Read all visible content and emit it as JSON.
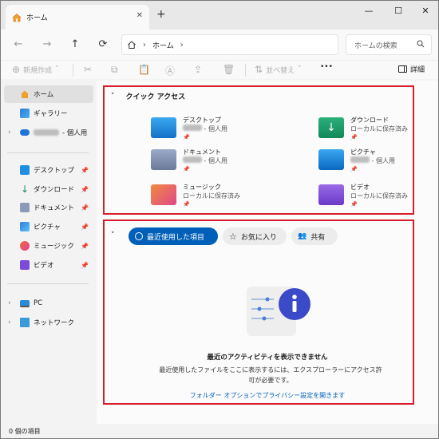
{
  "titlebar": {
    "tab_title": "ホーム",
    "new_tab": "+",
    "close_tab": "✕"
  },
  "window_controls": {
    "minimize": "—",
    "maximize": "☐",
    "close": "✕"
  },
  "address": {
    "separator": "›",
    "path": "ホーム",
    "trailing": "›"
  },
  "search": {
    "placeholder": "ホームの検索"
  },
  "commandbar": {
    "new": "新規作成",
    "sort": "並べ替え",
    "more": "•••",
    "details": "詳細"
  },
  "sidebar": {
    "home": "ホーム",
    "gallery": "ギャラリー",
    "cloud_suffix": "- 個人用",
    "pinned": [
      {
        "label": "デスクトップ"
      },
      {
        "label": "ダウンロード"
      },
      {
        "label": "ドキュメント"
      },
      {
        "label": "ピクチャ"
      },
      {
        "label": "ミュージック"
      },
      {
        "label": "ビデオ"
      }
    ],
    "pc": "PC",
    "network": "ネットワーク"
  },
  "quick_access": {
    "title": "クイック アクセス",
    "items": [
      {
        "name": "デスクトップ",
        "sub": "- 個人用",
        "blurred": true
      },
      {
        "name": "ダウンロード",
        "sub": "ローカルに保存済み",
        "blurred": false
      },
      {
        "name": "ドキュメント",
        "sub": "- 個人用",
        "blurred": true
      },
      {
        "name": "ピクチャ",
        "sub": "- 個人用",
        "blurred": true
      },
      {
        "name": "ミュージック",
        "sub": "ローカルに保存済み",
        "blurred": false
      },
      {
        "name": "ビデオ",
        "sub": "ローカルに保存済み",
        "blurred": false
      }
    ]
  },
  "recent": {
    "tabs": [
      {
        "label": "最近使用した項目",
        "active": true
      },
      {
        "label": "お気に入り",
        "active": false
      },
      {
        "label": "共有",
        "active": false
      }
    ],
    "empty_title": "最近のアクティビティを表示できません",
    "empty_desc": "最近使用したファイルをここに表示するには、エクスプローラーにアクセス許可が必要です。",
    "link": "フォルダー オプションでプライバシー設定を開きます"
  },
  "status": {
    "count": "0 個の項目"
  },
  "colors": {
    "accent": "#005fb8",
    "highlight_border": "#d81e2a"
  }
}
